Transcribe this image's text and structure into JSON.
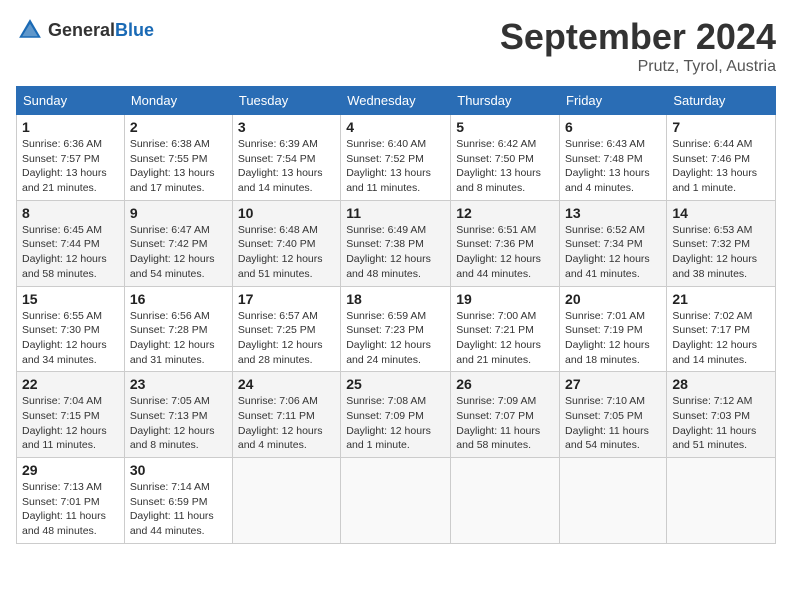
{
  "header": {
    "logo_general": "General",
    "logo_blue": "Blue",
    "title": "September 2024",
    "location": "Prutz, Tyrol, Austria"
  },
  "weekdays": [
    "Sunday",
    "Monday",
    "Tuesday",
    "Wednesday",
    "Thursday",
    "Friday",
    "Saturday"
  ],
  "weeks": [
    [
      {
        "day": "1",
        "sunrise": "Sunrise: 6:36 AM",
        "sunset": "Sunset: 7:57 PM",
        "daylight": "Daylight: 13 hours and 21 minutes."
      },
      {
        "day": "2",
        "sunrise": "Sunrise: 6:38 AM",
        "sunset": "Sunset: 7:55 PM",
        "daylight": "Daylight: 13 hours and 17 minutes."
      },
      {
        "day": "3",
        "sunrise": "Sunrise: 6:39 AM",
        "sunset": "Sunset: 7:54 PM",
        "daylight": "Daylight: 13 hours and 14 minutes."
      },
      {
        "day": "4",
        "sunrise": "Sunrise: 6:40 AM",
        "sunset": "Sunset: 7:52 PM",
        "daylight": "Daylight: 13 hours and 11 minutes."
      },
      {
        "day": "5",
        "sunrise": "Sunrise: 6:42 AM",
        "sunset": "Sunset: 7:50 PM",
        "daylight": "Daylight: 13 hours and 8 minutes."
      },
      {
        "day": "6",
        "sunrise": "Sunrise: 6:43 AM",
        "sunset": "Sunset: 7:48 PM",
        "daylight": "Daylight: 13 hours and 4 minutes."
      },
      {
        "day": "7",
        "sunrise": "Sunrise: 6:44 AM",
        "sunset": "Sunset: 7:46 PM",
        "daylight": "Daylight: 13 hours and 1 minute."
      }
    ],
    [
      {
        "day": "8",
        "sunrise": "Sunrise: 6:45 AM",
        "sunset": "Sunset: 7:44 PM",
        "daylight": "Daylight: 12 hours and 58 minutes."
      },
      {
        "day": "9",
        "sunrise": "Sunrise: 6:47 AM",
        "sunset": "Sunset: 7:42 PM",
        "daylight": "Daylight: 12 hours and 54 minutes."
      },
      {
        "day": "10",
        "sunrise": "Sunrise: 6:48 AM",
        "sunset": "Sunset: 7:40 PM",
        "daylight": "Daylight: 12 hours and 51 minutes."
      },
      {
        "day": "11",
        "sunrise": "Sunrise: 6:49 AM",
        "sunset": "Sunset: 7:38 PM",
        "daylight": "Daylight: 12 hours and 48 minutes."
      },
      {
        "day": "12",
        "sunrise": "Sunrise: 6:51 AM",
        "sunset": "Sunset: 7:36 PM",
        "daylight": "Daylight: 12 hours and 44 minutes."
      },
      {
        "day": "13",
        "sunrise": "Sunrise: 6:52 AM",
        "sunset": "Sunset: 7:34 PM",
        "daylight": "Daylight: 12 hours and 41 minutes."
      },
      {
        "day": "14",
        "sunrise": "Sunrise: 6:53 AM",
        "sunset": "Sunset: 7:32 PM",
        "daylight": "Daylight: 12 hours and 38 minutes."
      }
    ],
    [
      {
        "day": "15",
        "sunrise": "Sunrise: 6:55 AM",
        "sunset": "Sunset: 7:30 PM",
        "daylight": "Daylight: 12 hours and 34 minutes."
      },
      {
        "day": "16",
        "sunrise": "Sunrise: 6:56 AM",
        "sunset": "Sunset: 7:28 PM",
        "daylight": "Daylight: 12 hours and 31 minutes."
      },
      {
        "day": "17",
        "sunrise": "Sunrise: 6:57 AM",
        "sunset": "Sunset: 7:25 PM",
        "daylight": "Daylight: 12 hours and 28 minutes."
      },
      {
        "day": "18",
        "sunrise": "Sunrise: 6:59 AM",
        "sunset": "Sunset: 7:23 PM",
        "daylight": "Daylight: 12 hours and 24 minutes."
      },
      {
        "day": "19",
        "sunrise": "Sunrise: 7:00 AM",
        "sunset": "Sunset: 7:21 PM",
        "daylight": "Daylight: 12 hours and 21 minutes."
      },
      {
        "day": "20",
        "sunrise": "Sunrise: 7:01 AM",
        "sunset": "Sunset: 7:19 PM",
        "daylight": "Daylight: 12 hours and 18 minutes."
      },
      {
        "day": "21",
        "sunrise": "Sunrise: 7:02 AM",
        "sunset": "Sunset: 7:17 PM",
        "daylight": "Daylight: 12 hours and 14 minutes."
      }
    ],
    [
      {
        "day": "22",
        "sunrise": "Sunrise: 7:04 AM",
        "sunset": "Sunset: 7:15 PM",
        "daylight": "Daylight: 12 hours and 11 minutes."
      },
      {
        "day": "23",
        "sunrise": "Sunrise: 7:05 AM",
        "sunset": "Sunset: 7:13 PM",
        "daylight": "Daylight: 12 hours and 8 minutes."
      },
      {
        "day": "24",
        "sunrise": "Sunrise: 7:06 AM",
        "sunset": "Sunset: 7:11 PM",
        "daylight": "Daylight: 12 hours and 4 minutes."
      },
      {
        "day": "25",
        "sunrise": "Sunrise: 7:08 AM",
        "sunset": "Sunset: 7:09 PM",
        "daylight": "Daylight: 12 hours and 1 minute."
      },
      {
        "day": "26",
        "sunrise": "Sunrise: 7:09 AM",
        "sunset": "Sunset: 7:07 PM",
        "daylight": "Daylight: 11 hours and 58 minutes."
      },
      {
        "day": "27",
        "sunrise": "Sunrise: 7:10 AM",
        "sunset": "Sunset: 7:05 PM",
        "daylight": "Daylight: 11 hours and 54 minutes."
      },
      {
        "day": "28",
        "sunrise": "Sunrise: 7:12 AM",
        "sunset": "Sunset: 7:03 PM",
        "daylight": "Daylight: 11 hours and 51 minutes."
      }
    ],
    [
      {
        "day": "29",
        "sunrise": "Sunrise: 7:13 AM",
        "sunset": "Sunset: 7:01 PM",
        "daylight": "Daylight: 11 hours and 48 minutes."
      },
      {
        "day": "30",
        "sunrise": "Sunrise: 7:14 AM",
        "sunset": "Sunset: 6:59 PM",
        "daylight": "Daylight: 11 hours and 44 minutes."
      },
      null,
      null,
      null,
      null,
      null
    ]
  ]
}
